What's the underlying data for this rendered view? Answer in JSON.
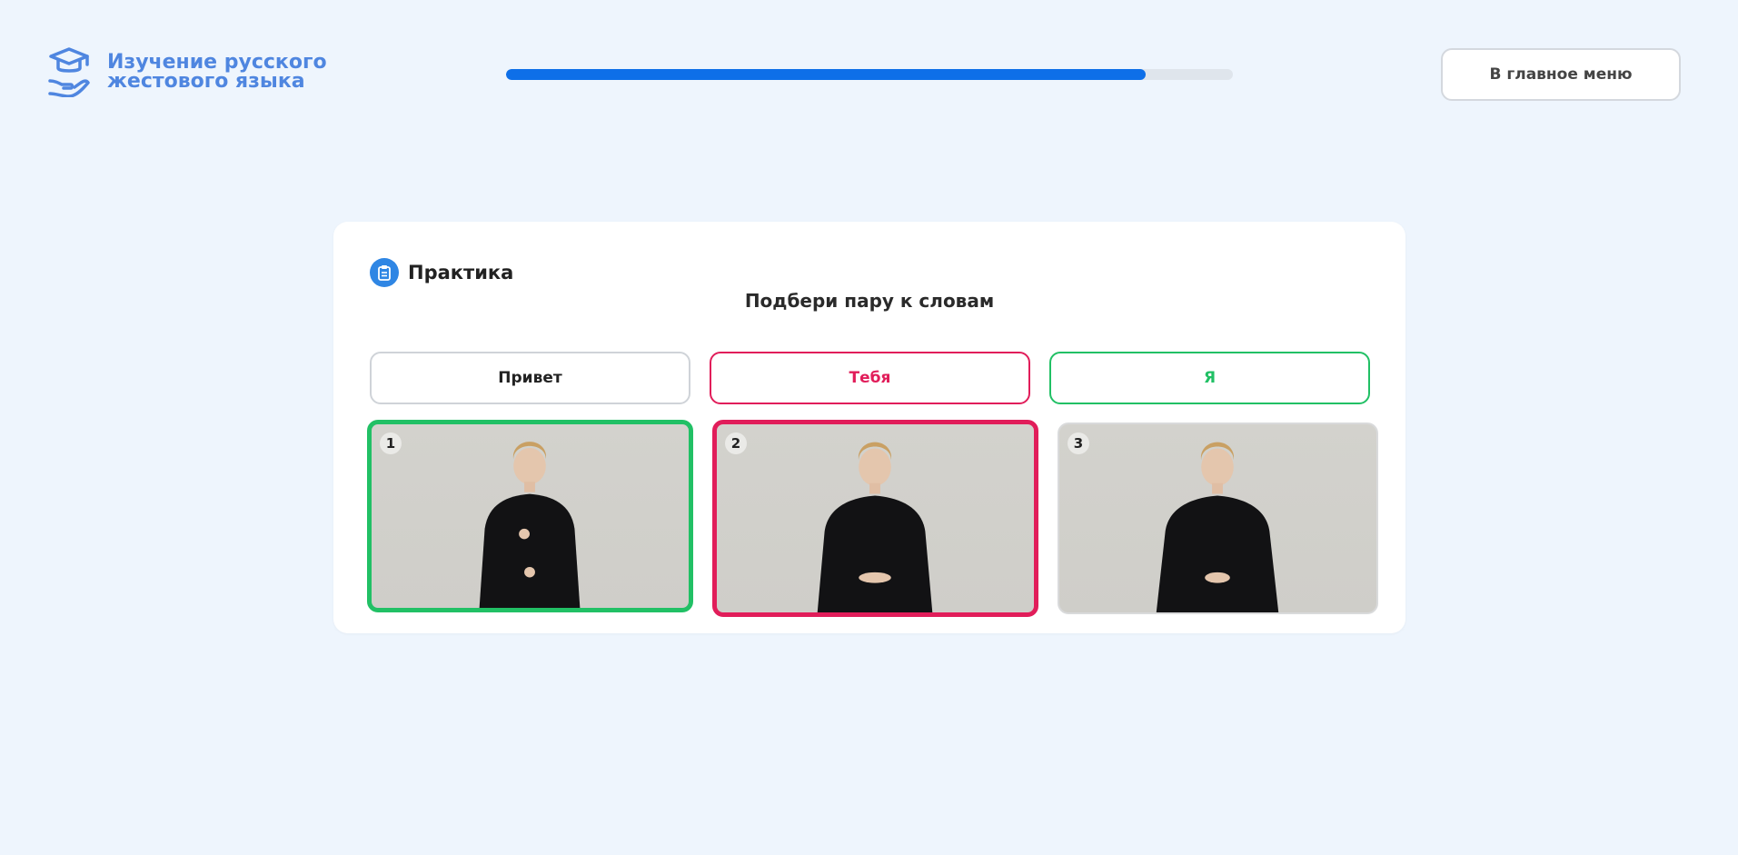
{
  "header": {
    "logo_text": "Изучение русского\nжестового языка",
    "logo_icon": "graduation-cap-hand-icon",
    "progress_percent": 88,
    "menu_button_label": "В главное меню"
  },
  "card": {
    "icon": "clipboard-icon",
    "title": "Практика",
    "task": "Подбери пару к словам",
    "words": [
      {
        "label": "Привет",
        "state": "neutral"
      },
      {
        "label": "Тебя",
        "state": "wrong"
      },
      {
        "label": "Я",
        "state": "correct"
      }
    ],
    "videos": [
      {
        "number": "1",
        "state": "correct"
      },
      {
        "number": "2",
        "state": "wrong"
      },
      {
        "number": "3",
        "state": "neutral"
      }
    ]
  },
  "colors": {
    "background": "#eef5fd",
    "accent": "#0e6fe8",
    "logo": "#4f86e0",
    "correct": "#21c065",
    "wrong": "#e11d5a"
  }
}
